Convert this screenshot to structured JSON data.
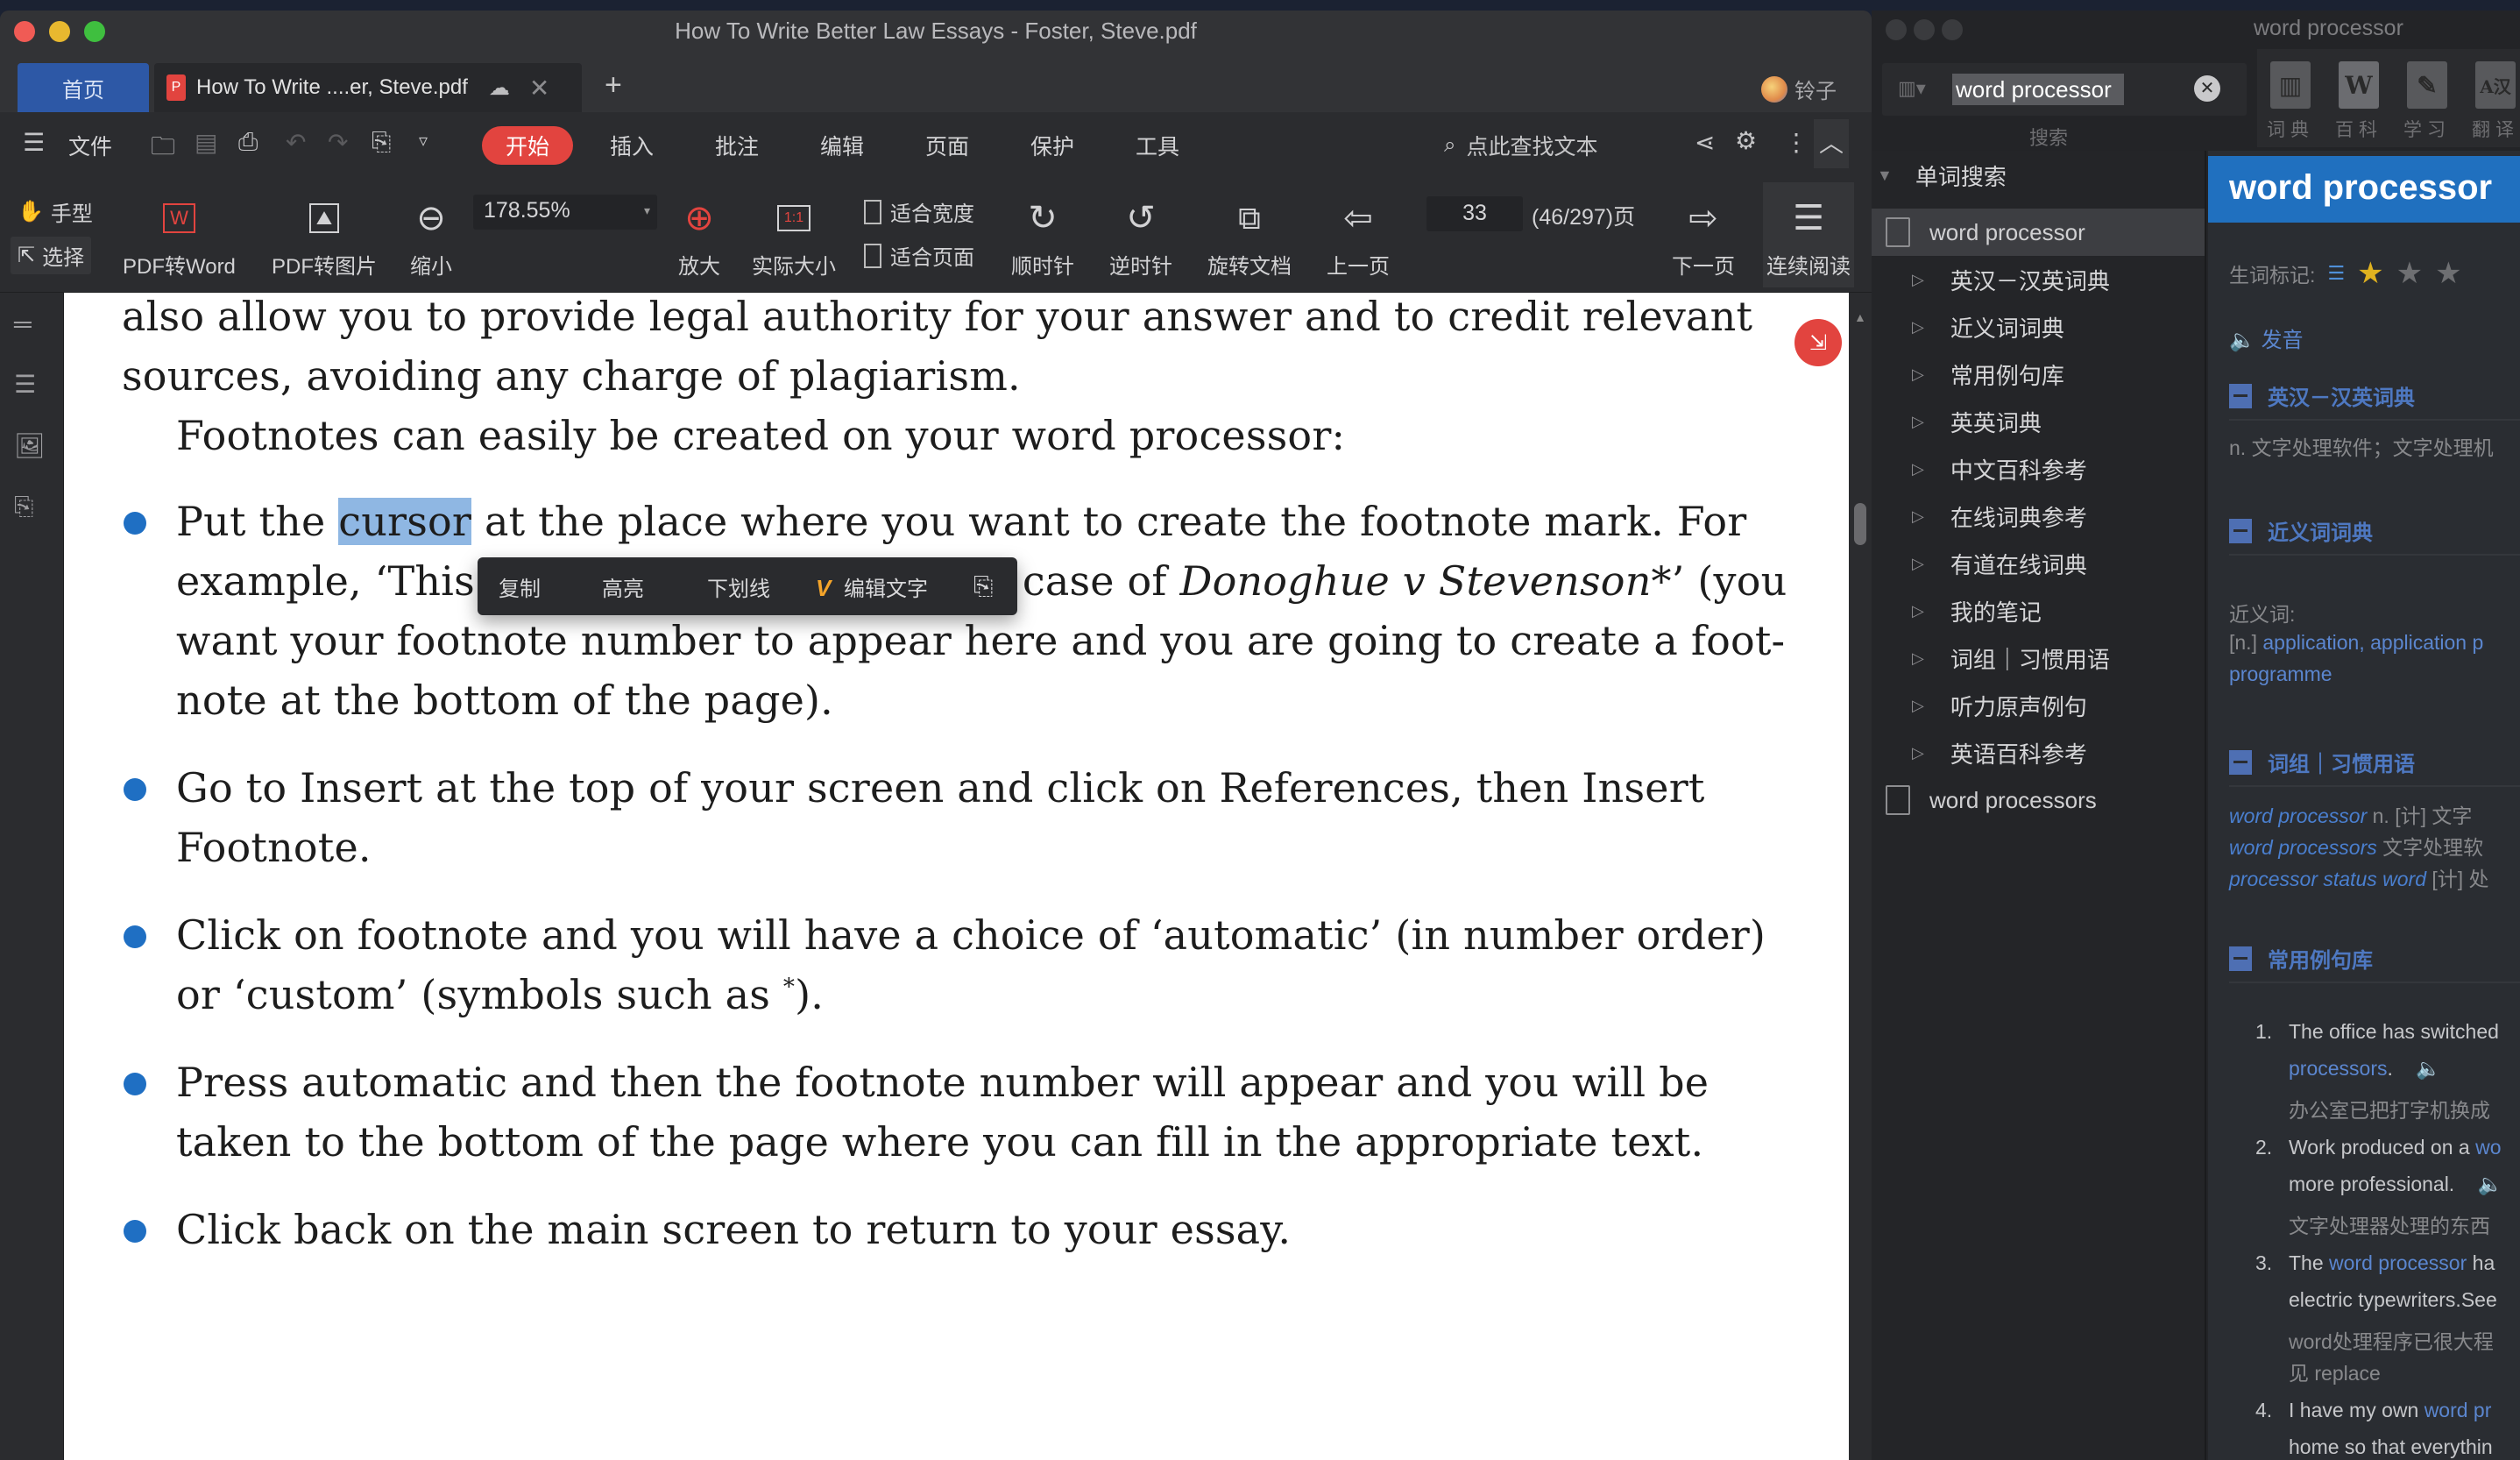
{
  "main_window": {
    "title": "How To Write Better Law Essays - Foster, Steve.pdf",
    "tabs": {
      "home": "首页",
      "doc": "How To Write ....er, Steve.pdf",
      "add": "+"
    },
    "user_name": "铃子",
    "menu": {
      "file": "文件",
      "items": [
        "开始",
        "插入",
        "批注",
        "编辑",
        "页面",
        "保护",
        "工具"
      ],
      "search_placeholder": "点此查找文本"
    },
    "ribbon": {
      "hand": "手型",
      "select": "选择",
      "pdf_to_word": "PDF转Word",
      "pdf_to_image": "PDF转图片",
      "zoom_out": "缩小",
      "zoom_value": "178.55%",
      "zoom_in": "放大",
      "actual_size": "实际大小",
      "fit_width": "适合宽度",
      "fit_page": "适合页面",
      "rotate_cw": "顺时针",
      "rotate_ccw": "逆时针",
      "rotate_doc": "旋转文档",
      "prev_page": "上一页",
      "page_input": "33",
      "page_total": "(46/297)页",
      "next_page": "下一页",
      "continuous": "连续阅读"
    },
    "document": {
      "line1": "also allow you to provide legal authority for your answer and to credit relevant",
      "line2": "sources, avoiding any charge of plagiarism.",
      "line3": "Footnotes can easily be created on your word processor:",
      "b1": {
        "l1_pre": "Put the ",
        "l1_sel": "cursor",
        "l1_post": " at the place where you want to create the footnote mark. For",
        "l2_pre": "example, ‘This",
        "l2_mid": "case of ",
        "l2_ital": "Donoghue v Stevenson",
        "l2_post": "*’ (you",
        "l3": "want your footnote number to appear here and you are going to create a foot-",
        "l4": "note at the bottom of the page)."
      },
      "b2": {
        "l1": "Go to Insert at the top of your screen and click on References, then Insert",
        "l2": "Footnote."
      },
      "b3": {
        "l1": "Click on footnote and you will have a choice of ‘automatic’ (in number order)",
        "l2_pre": "or ‘custom’ (symbols such as ",
        "l2_sup": "*",
        "l2_post": ")."
      },
      "b4": {
        "l1": "Press automatic and then the footnote number will appear and you will be",
        "l2": "taken to the bottom of the page where you can fill in the appropriate text."
      },
      "b5": {
        "l1": "Click back on the main screen to return to your essay."
      }
    },
    "context_menu": {
      "copy": "复制",
      "highlight": "高亮",
      "underline": "下划线",
      "vip": "V",
      "edit_text": "编辑文字"
    },
    "colors": {
      "accent_red": "#e2443f",
      "home_tab_blue": "#2d58a6",
      "bullet_blue": "#1f6fc3",
      "selection": "#8fb7e3"
    }
  },
  "dictionary": {
    "title": "word processor",
    "search_value": "word processor",
    "search_label": "搜索",
    "tools": [
      "词典",
      "百科",
      "学习",
      "翻译"
    ],
    "list_header": "单词搜索",
    "entries": [
      {
        "word": "word processor",
        "sources": [
          "英汉－汉英词典",
          "近义词词典",
          "常用例句库",
          "英英词典",
          "中文百科参考",
          "在线词典参考",
          "有道在线词典",
          "我的笔记",
          "词组｜习惯用语",
          "听力原声例句",
          "英语百科参考"
        ]
      },
      {
        "word": "word processors"
      }
    ],
    "detail": {
      "headword": "word processor",
      "mark_label": "生词标记:",
      "star_rating": "1 of 3",
      "pronounce": "发音",
      "sec_enzh": "英汉－汉英词典",
      "def": "n. 文字处理软件；文字处理机",
      "sec_syn": "近义词词典",
      "syn_label": "近义词:",
      "syn_pos": "[n.]",
      "syn_words": "application, application p",
      "syn_word2": "programme",
      "sec_phrase": "词组｜习惯用语",
      "phrases": [
        {
          "term": "word processor",
          "gloss": "n. [计] 文字"
        },
        {
          "term": "word processors",
          "gloss": "文字处理软"
        },
        {
          "term": "processor status word",
          "gloss": "[计] 处"
        }
      ],
      "sec_examples": "常用例句库",
      "examples": [
        {
          "num": "1.",
          "l1": "The office has switched",
          "l2_link": "processors",
          "l2_rest": ".",
          "zh": "办公室已把打字机换成"
        },
        {
          "num": "2.",
          "l1_pre": "Work produced on a ",
          "l1_link": "wo",
          "l2": "more professional.",
          "zh": "文字处理器处理的东西"
        },
        {
          "num": "3.",
          "l1_pre": "The ",
          "l1_link": "word processor",
          "l1_post": " ha",
          "l2": "electric typewriters.See",
          "zh": "word处理程序已很大程",
          "zh2": "见 replace"
        },
        {
          "num": "4.",
          "l1_pre": "I have my own ",
          "l1_link": "word pr",
          "l2": "home so that everythin"
        }
      ]
    }
  }
}
